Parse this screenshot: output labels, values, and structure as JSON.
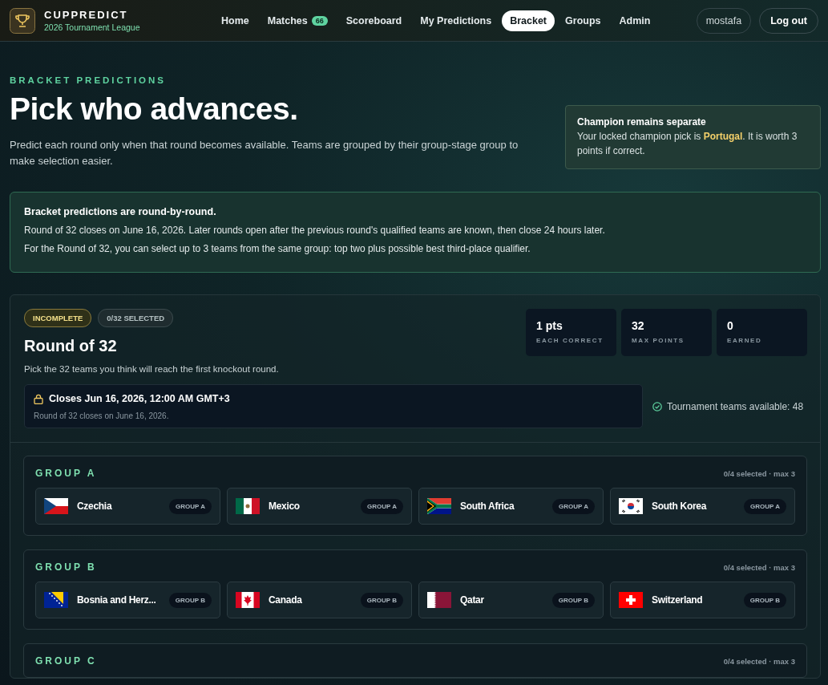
{
  "brand": {
    "name": "CUPPREDICT",
    "subtitle": "2026 Tournament League"
  },
  "nav": [
    {
      "label": "Home",
      "selected": false
    },
    {
      "label": "Matches",
      "badge": "66",
      "selected": false
    },
    {
      "label": "Scoreboard",
      "selected": false
    },
    {
      "label": "My Predictions",
      "selected": false
    },
    {
      "label": "Bracket",
      "selected": true
    },
    {
      "label": "Groups",
      "selected": false
    },
    {
      "label": "Admin",
      "selected": false
    }
  ],
  "user": {
    "name": "mostafa",
    "logout": "Log out"
  },
  "hero": {
    "eyebrow": "BRACKET PREDICTIONS",
    "title": "Pick who advances.",
    "description": "Predict each round only when that round becomes available. Teams are grouped by their group-stage group to make selection easier."
  },
  "champion_note": {
    "title": "Champion remains separate",
    "text": "Your locked champion pick is **Portugal**. It is worth 3 points if correct."
  },
  "info": {
    "title": "Bracket predictions are round-by-round.",
    "lines": [
      "Round of 32 closes on June 16, 2026. Later rounds open after the previous round's qualified teams are known, then close 24 hours later.",
      "For the Round of 32, you can select up to 3 teams from the same group: top two plus possible best third-place qualifier."
    ]
  },
  "round": {
    "status": "INCOMPLETE",
    "selected_count": "0/32 SELECTED",
    "title": "Round of 32",
    "description": "Pick the 32 teams you think will reach the first knockout round.",
    "stats": [
      {
        "value": "1 pts",
        "label": "EACH CORRECT"
      },
      {
        "value": "32",
        "label": "MAX POINTS"
      },
      {
        "value": "0",
        "label": "EARNED"
      }
    ],
    "deadline": {
      "title": "Closes Jun 16, 2026, 12:00 AM GMT+3",
      "subtitle": "Round of 32 closes on June 16, 2026."
    },
    "availability": "Tournament teams available: 48",
    "groups": [
      {
        "name": "GROUP A",
        "count": "0/4 selected · max 3",
        "teams": [
          {
            "name": "Czechia",
            "tag": "GROUP A",
            "kind": "cz",
            "selected": false
          },
          {
            "name": "Mexico",
            "tag": "GROUP A",
            "kind": "mx",
            "selected": false
          },
          {
            "name": "South Africa",
            "tag": "GROUP A",
            "kind": "za",
            "selected": false
          },
          {
            "name": "South Korea",
            "tag": "GROUP A",
            "kind": "kr",
            "selected": false
          }
        ]
      },
      {
        "name": "GROUP B",
        "count": "0/4 selected · max 3",
        "teams": [
          {
            "name": "Bosnia and Herz...",
            "tag": "GROUP B",
            "kind": "ba",
            "selected": false
          },
          {
            "name": "Canada",
            "tag": "GROUP B",
            "kind": "ca",
            "selected": false
          },
          {
            "name": "Qatar",
            "tag": "GROUP B",
            "kind": "qa",
            "selected": false
          },
          {
            "name": "Switzerland",
            "tag": "GROUP B",
            "kind": "ch",
            "selected": false
          }
        ]
      },
      {
        "name": "GROUP C",
        "count": "0/4 selected · max 3"
      }
    ]
  }
}
